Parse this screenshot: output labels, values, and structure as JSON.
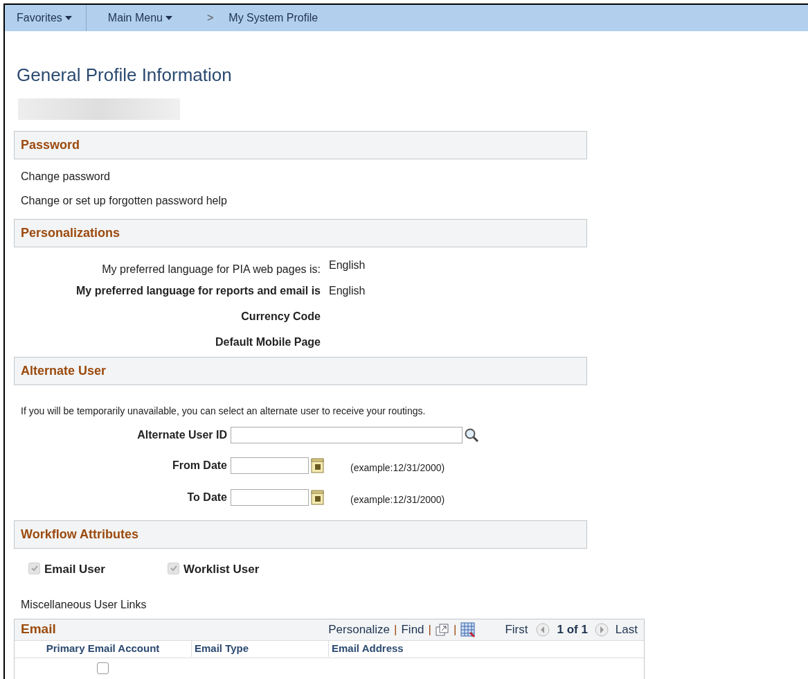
{
  "nav": {
    "favorites": "Favorites",
    "main_menu": "Main Menu",
    "separator": ">",
    "current": "My System Profile"
  },
  "title": "General Profile Information",
  "password": {
    "header": "Password",
    "links": [
      "Change password",
      "Change or set up forgotten password help"
    ]
  },
  "personalizations": {
    "header": "Personalizations",
    "rows": [
      {
        "label": "My preferred language for PIA web pages is:",
        "value": "English",
        "kind": "plain"
      },
      {
        "label": "My preferred language for reports and email is",
        "value": "English",
        "kind": "bold"
      },
      {
        "label": "Currency Code",
        "kind": "bold"
      },
      {
        "label": "Default Mobile Page",
        "kind": "bold"
      }
    ]
  },
  "alternate_user": {
    "header": "Alternate User",
    "note": "If you will be temporarily unavailable, you can select an alternate user to receive your routings.",
    "user_id_label": "Alternate User ID",
    "dates": [
      {
        "label": "From Date",
        "example": "(example:12/31/2000)"
      },
      {
        "label": "To Date",
        "example": "(example:12/31/2000)"
      }
    ]
  },
  "workflow": {
    "header": "Workflow Attributes",
    "checkboxes": [
      {
        "label": "Email User",
        "checked": true,
        "disabled": true
      },
      {
        "label": "Worklist User",
        "checked": true,
        "disabled": true
      }
    ]
  },
  "misc_link": "Miscellaneous User Links",
  "email_grid": {
    "title": "Email",
    "links": [
      "Personalize",
      "Find"
    ],
    "dividers": [
      "|",
      "|",
      "|"
    ],
    "first": "First",
    "count": "1 of 1",
    "last": "Last",
    "columns": [
      "Primary Email Account",
      "Email Type",
      "Email Address"
    ],
    "rows": [
      {
        "primary": false
      }
    ]
  }
}
